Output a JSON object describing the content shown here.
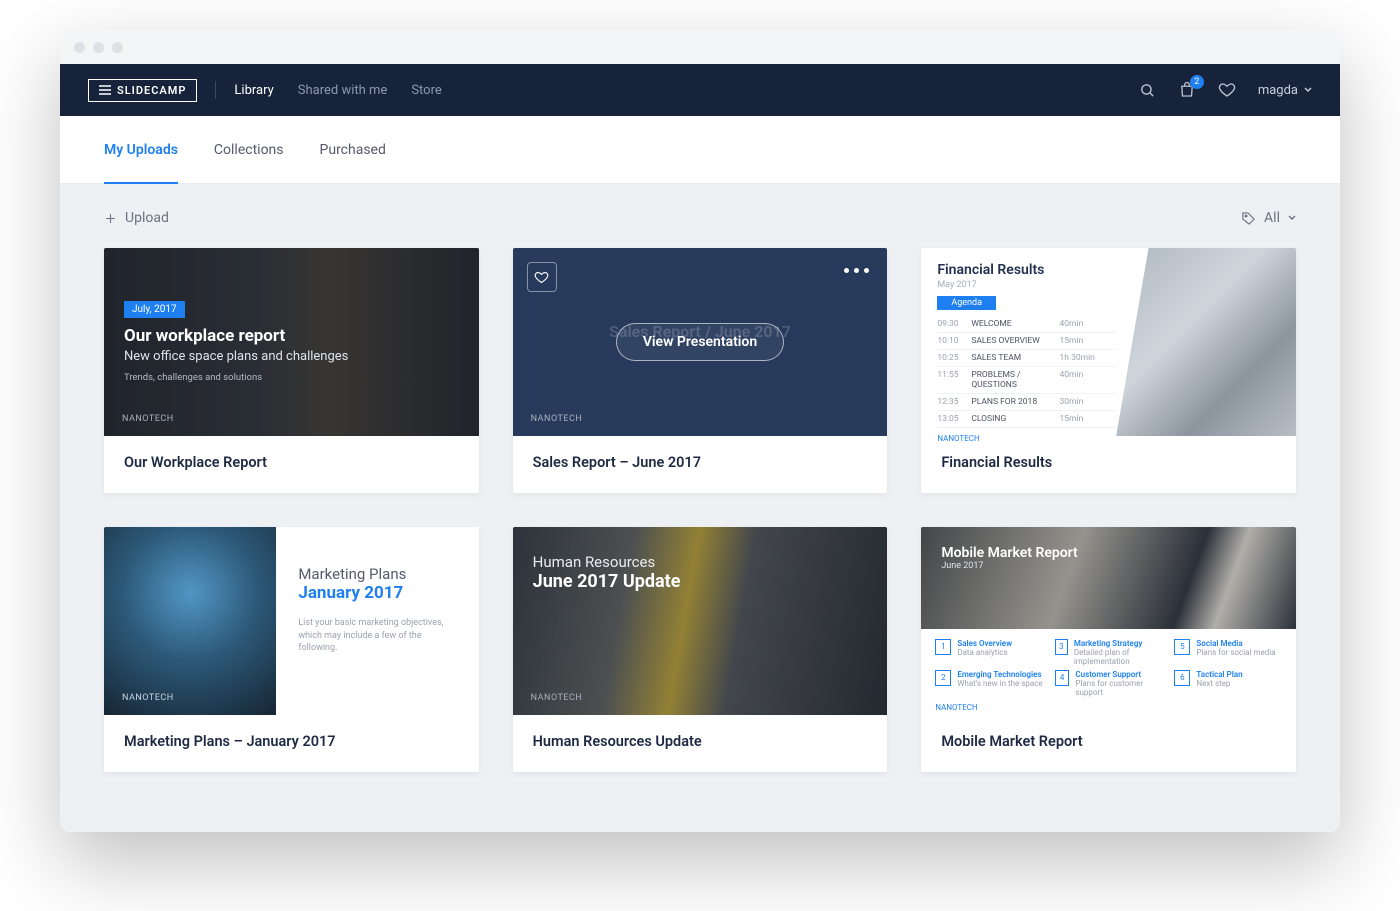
{
  "brand": "SLIDECAMP",
  "nav": {
    "links": [
      "Library",
      "Shared with me",
      "Store"
    ],
    "active": 0,
    "cart_badge": "2",
    "user": "magda"
  },
  "subtabs": {
    "items": [
      "My Uploads",
      "Collections",
      "Purchased"
    ],
    "active": 0
  },
  "toolbar": {
    "upload": "Upload",
    "filter": "All"
  },
  "cards": [
    {
      "title": "Our Workplace Report",
      "thumb": {
        "date_badge": "July, 2017",
        "headline": "Our workplace report",
        "subline": "New office space plans and challenges",
        "tiny": "Trends, challenges and solutions",
        "brand": "NANOTECH"
      }
    },
    {
      "title": "Sales Report – June 2017",
      "thumb": {
        "ghost_title": "Sales Report / June 2017",
        "view_btn": "View Presentation",
        "brand": "NANOTECH"
      }
    },
    {
      "title": "Financial Results",
      "thumb": {
        "heading": "Financial Results",
        "date": "May 2017",
        "agenda_label": "Agenda",
        "rows": [
          {
            "t": "09:30",
            "n": "WELCOME",
            "d": "40min"
          },
          {
            "t": "10:10",
            "n": "SALES OVERVIEW",
            "d": "15min"
          },
          {
            "t": "10:25",
            "n": "SALES TEAM",
            "d": "1h 30min"
          },
          {
            "t": "11:55",
            "n": "PROBLEMS / QUESTIONS",
            "d": "40min"
          },
          {
            "t": "12:35",
            "n": "PLANS FOR 2018",
            "d": "30min"
          },
          {
            "t": "13:05",
            "n": "CLOSING",
            "d": "15min"
          }
        ],
        "brand": "NANOTECH"
      }
    },
    {
      "title": "Marketing Plans – January 2017",
      "thumb": {
        "line1": "Marketing Plans",
        "line2": "January 2017",
        "desc": "List your basic marketing objectives, which may include a few of the following.",
        "brand": "NANOTECH"
      }
    },
    {
      "title": "Human Resources Update",
      "thumb": {
        "line1": "Human Resources",
        "line2": "June 2017 Update",
        "brand": "NANOTECH"
      }
    },
    {
      "title": "Mobile Market Report",
      "thumb": {
        "line1": "Mobile Market Report",
        "line2": "June 2017",
        "items": [
          {
            "n": "1",
            "t": "Sales Overview",
            "s": "Data analytics"
          },
          {
            "n": "3",
            "t": "Marketing Strategy",
            "s": "Detailed plan of implementation"
          },
          {
            "n": "5",
            "t": "Social Media",
            "s": "Plans for social media"
          },
          {
            "n": "2",
            "t": "Emerging Technologies",
            "s": "What's new in the space"
          },
          {
            "n": "4",
            "t": "Customer Support",
            "s": "Plans for customer support"
          },
          {
            "n": "6",
            "t": "Tactical Plan",
            "s": "Next step"
          }
        ],
        "brand": "NANOTECH"
      }
    }
  ]
}
